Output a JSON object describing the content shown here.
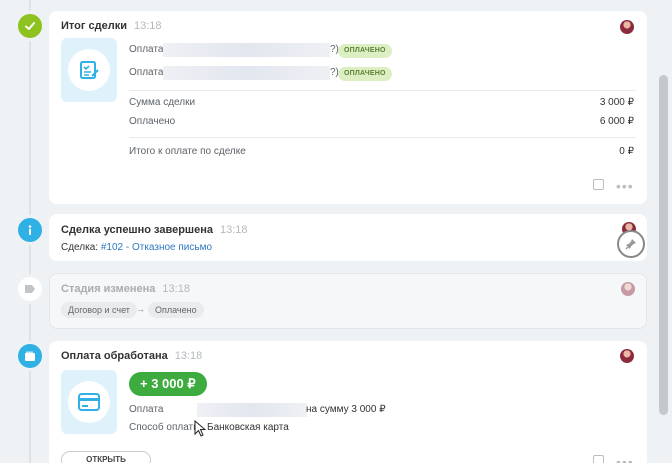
{
  "deal_summary": {
    "title": "Итог сделки",
    "time": "13:18",
    "payments": [
      {
        "label": "Оплата",
        "suffix": "?)",
        "status": "ОПЛАЧЕНО"
      },
      {
        "label": "Оплата",
        "suffix": "?)",
        "status": "ОПЛАЧЕНО"
      }
    ],
    "sum_label": "Сумма сделки",
    "sum_value": "3 000 ₽",
    "paid_label": "Оплачено",
    "paid_value": "6 000 ₽",
    "due_label": "Итого к оплате по сделке",
    "due_value": "0 ₽"
  },
  "deal_completed": {
    "title": "Сделка успешно завершена",
    "time": "13:18",
    "deal_prefix": "Сделка: ",
    "deal_link": "#102 - Отказное письмо"
  },
  "stage_changed": {
    "title": "Стадия изменена",
    "time": "13:18",
    "from": "Договор и счет",
    "arrow": "→",
    "to": "Оплачено"
  },
  "payment_processed": {
    "title": "Оплата обработана",
    "time": "13:18",
    "amount": "+ 3 000 ₽",
    "payment_label": "Оплата",
    "payment_suffix": "на сумму 3 000 ₽",
    "method_label": "Способ оплаты",
    "method_value": "Банковская карта",
    "open_button": "ОТКРЫТЬ"
  },
  "icons": {
    "marker_1": "check-icon",
    "marker_2": "info-icon",
    "marker_3": "tag-icon",
    "marker_4": "wallet-icon",
    "summary": "checklist-icon",
    "payment": "credit-card-icon"
  },
  "colors": {
    "success_green": "#8ec21f",
    "info_blue": "#2fb1e6",
    "paid_badge_bg": "#dcefc3",
    "amount_green": "#3dab3d",
    "link_blue": "#2e78c0"
  }
}
